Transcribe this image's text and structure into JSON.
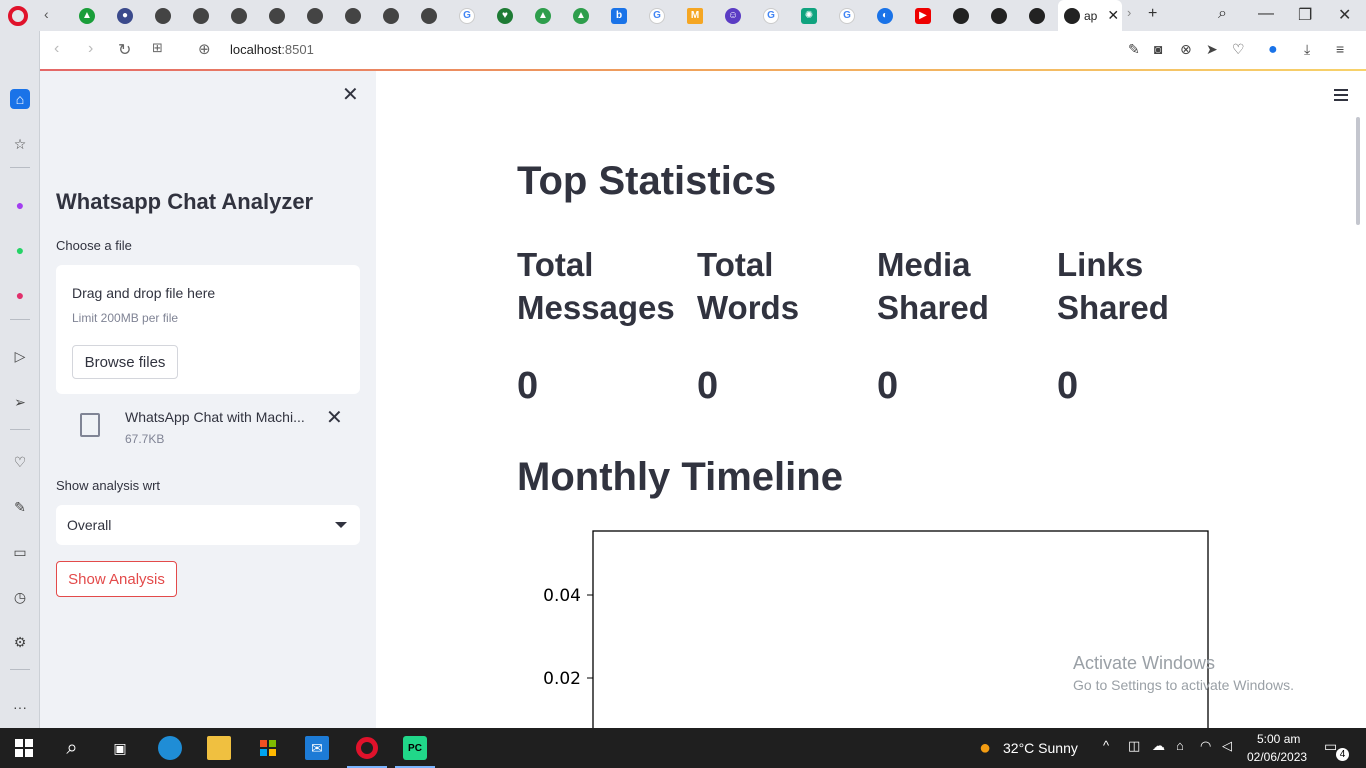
{
  "browser": {
    "active_tab_title": "ap",
    "url_host": "localhost",
    "url_port": ":8501"
  },
  "sidebar": {
    "title": "Whatsapp Chat Analyzer",
    "file_label": "Choose a file",
    "drag_text": "Drag and drop file here",
    "limit_text": "Limit 200MB per file",
    "browse_label": "Browse files",
    "uploaded_file": {
      "name": "WhatsApp Chat with Machi...",
      "size": "67.7KB"
    },
    "analysis_label": "Show analysis wrt",
    "analysis_selected": "Overall",
    "show_button": "Show Analysis"
  },
  "main": {
    "title": "Top Statistics",
    "stats": [
      {
        "line1": "Total",
        "line2": "Messages",
        "value": "0"
      },
      {
        "line1": "Total",
        "line2": "Words",
        "value": "0"
      },
      {
        "line1": "Media",
        "line2": "Shared",
        "value": "0"
      },
      {
        "line1": "Links",
        "line2": "Shared",
        "value": "0"
      }
    ],
    "timeline_title": "Monthly Timeline"
  },
  "chart_data": {
    "type": "line",
    "title": "",
    "xlabel": "",
    "ylabel": "",
    "yticks": [
      "0.04",
      "0.02"
    ],
    "series": []
  },
  "watermark": {
    "line1": "Activate Windows",
    "line2": "Go to Settings to activate Windows."
  },
  "taskbar": {
    "weather": "32°C  Sunny",
    "time": "5:00 am",
    "date": "02/06/2023",
    "notifications": "4"
  }
}
